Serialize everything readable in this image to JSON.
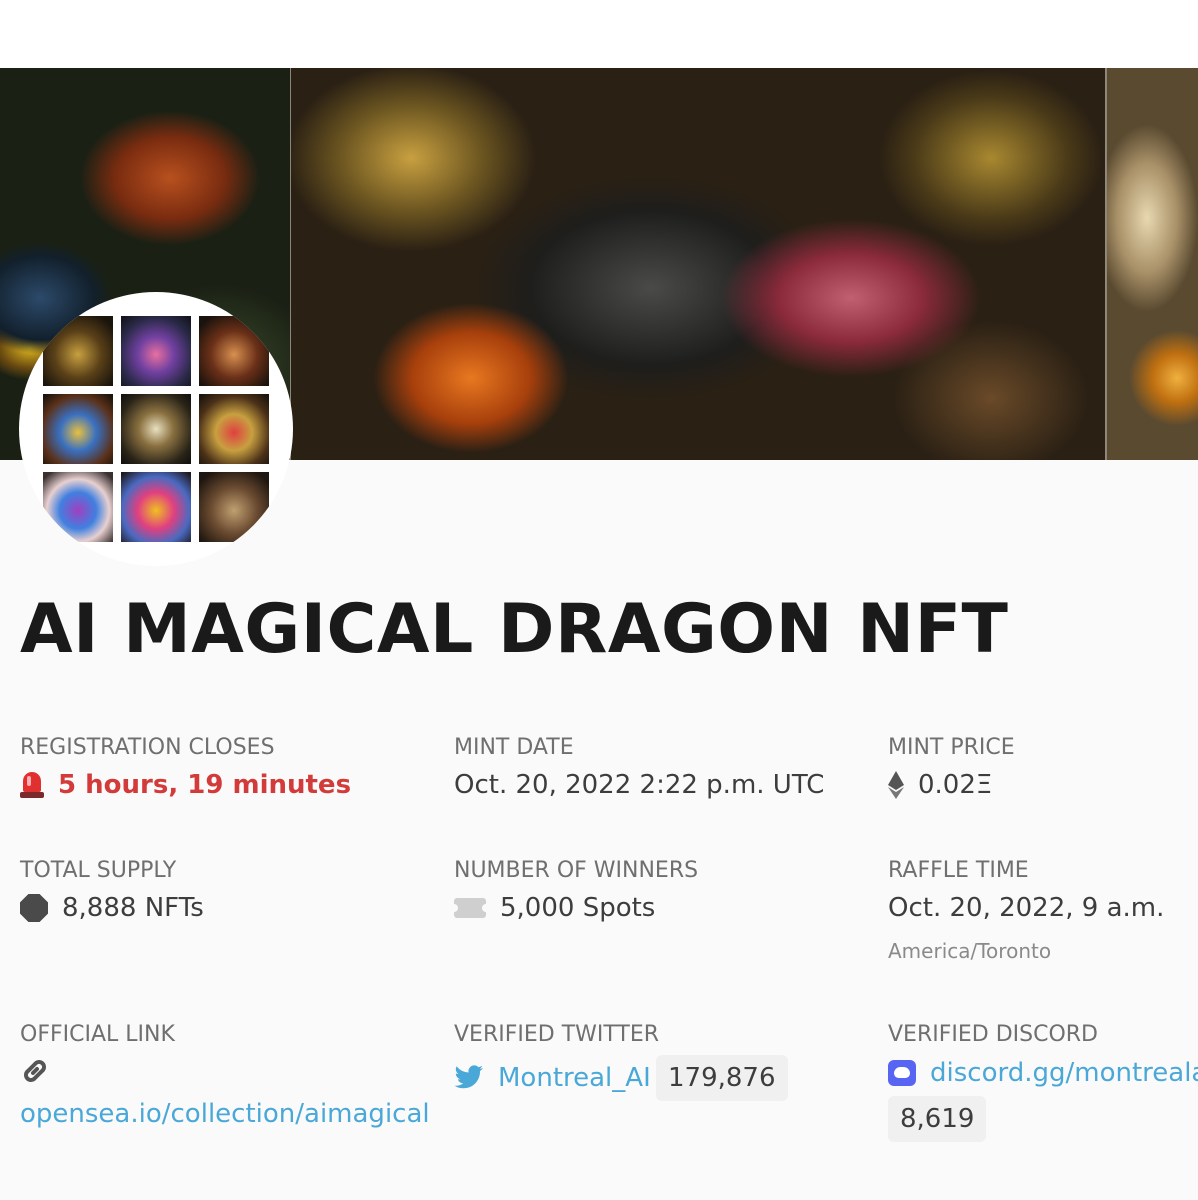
{
  "banner": {
    "description_icon": "dragon-artwork-banner"
  },
  "avatar": {
    "icon": "collection-avatar-grid"
  },
  "title": "AI MAGICAL DRAGON NFT",
  "registration": {
    "label": "REGISTRATION CLOSES",
    "value": "5 hours, 19 minutes",
    "icon": "siren-icon",
    "color": "#d33a3a"
  },
  "mint_date": {
    "label": "MINT DATE",
    "value": "Oct. 20, 2022 2:22 p.m. UTC"
  },
  "mint_price": {
    "label": "MINT PRICE",
    "value": "0.02Ξ",
    "icon": "ethereum-icon"
  },
  "total_supply": {
    "label": "TOTAL SUPPLY",
    "value": "8,888 NFTs",
    "icon": "octagon-icon"
  },
  "winners": {
    "label": "NUMBER OF WINNERS",
    "value": "5,000 Spots",
    "icon": "ticket-icon"
  },
  "raffle": {
    "label": "RAFFLE TIME",
    "value": "Oct. 20, 2022, 9 a.m.",
    "timezone": "America/Toronto"
  },
  "official_link": {
    "label": "OFFICIAL LINK",
    "value": "opensea.io/collection/aimagical",
    "icon": "link-icon"
  },
  "twitter": {
    "label": "VERIFIED TWITTER",
    "handle": "Montreal_AI",
    "followers": "179,876",
    "icon": "twitter-icon",
    "color": "#4aa8d8"
  },
  "discord": {
    "label": "VERIFIED DISCORD",
    "invite": "discord.gg/montrealai",
    "members": "8,619",
    "icon": "discord-icon",
    "color": "#5865f2"
  }
}
